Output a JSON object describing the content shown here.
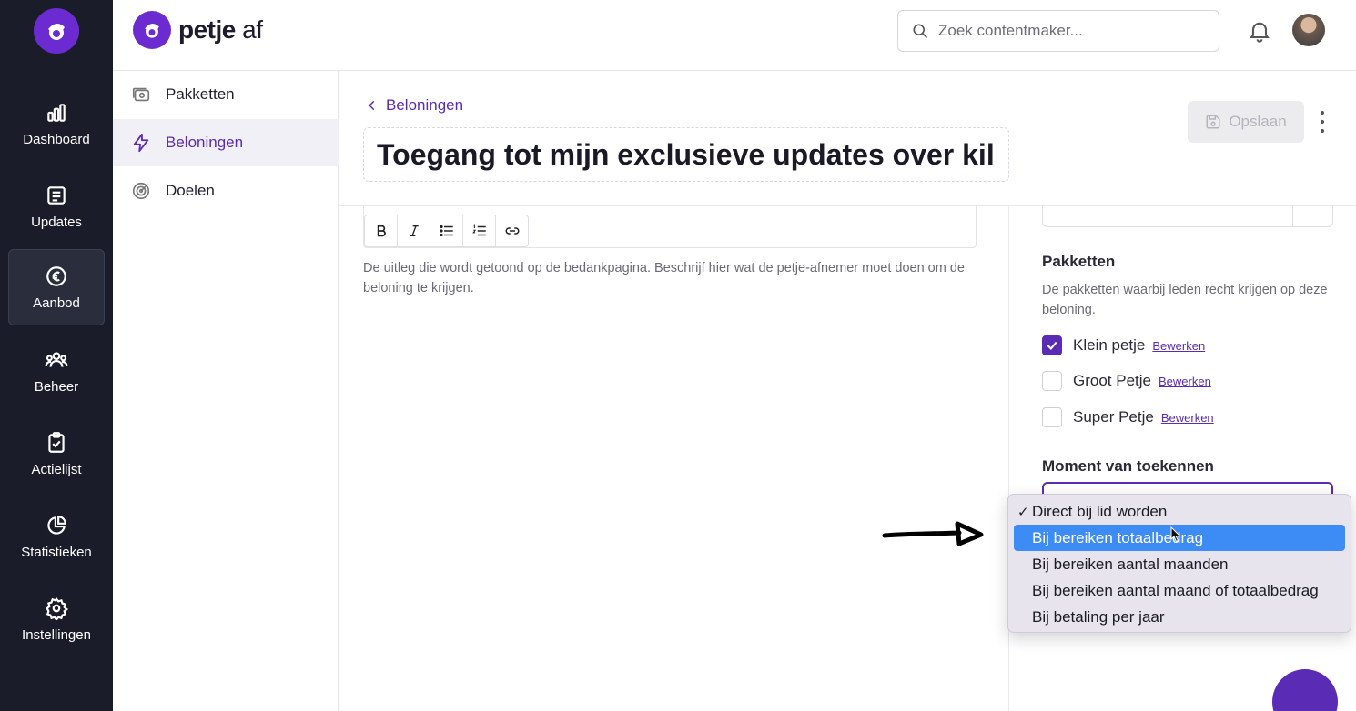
{
  "rail": {
    "items": [
      {
        "label": "Dashboard",
        "icon": "bar-chart-icon"
      },
      {
        "label": "Updates",
        "icon": "newspaper-icon"
      },
      {
        "label": "Aanbod",
        "icon": "euro-icon",
        "active": true
      },
      {
        "label": "Beheer",
        "icon": "users-icon"
      },
      {
        "label": "Actielijst",
        "icon": "clipboard-check-icon"
      },
      {
        "label": "Statistieken",
        "icon": "pie-chart-icon"
      },
      {
        "label": "Instellingen",
        "icon": "gear-icon"
      }
    ]
  },
  "topbar": {
    "brand_bold": "petje",
    "brand_light": "af",
    "search_placeholder": "Zoek contentmaker..."
  },
  "subnav": {
    "items": [
      {
        "label": "Pakketten",
        "icon": "package-icon"
      },
      {
        "label": "Beloningen",
        "icon": "lightning-icon",
        "active": true
      },
      {
        "label": "Doelen",
        "icon": "target-icon"
      }
    ]
  },
  "main": {
    "back_label": "Beloningen",
    "title": "Toegang tot mijn exclusieve updates over kil",
    "save_label": "Opslaan",
    "editor_hint": "De uitleg die wordt getoond op de bedankpagina. Beschrijf hier wat de petje-afnemer moet doen om de beloning te krijgen."
  },
  "panel": {
    "pakketten_title": "Pakketten",
    "pakketten_desc": "De pakketten waarbij leden recht krijgen op deze beloning.",
    "packages": [
      {
        "name": "Klein petje",
        "edit": "Bewerken",
        "checked": true
      },
      {
        "name": "Groot Petje",
        "edit": "Bewerken",
        "checked": false
      },
      {
        "name": "Super Petje",
        "edit": "Bewerken",
        "checked": false
      }
    ],
    "moment_title": "Moment van toekennen"
  },
  "dropdown": {
    "options": [
      {
        "label": "Direct bij lid worden",
        "selected": true
      },
      {
        "label": "Bij bereiken totaalbedrag",
        "highlighted": true
      },
      {
        "label": "Bij bereiken aantal maanden"
      },
      {
        "label": "Bij bereiken aantal maand of totaalbedrag"
      },
      {
        "label": "Bij betaling per jaar"
      }
    ]
  },
  "colors": {
    "brand": "#5a2bb5",
    "rail_bg": "#1a1d29",
    "highlight": "#3d8bf5"
  }
}
